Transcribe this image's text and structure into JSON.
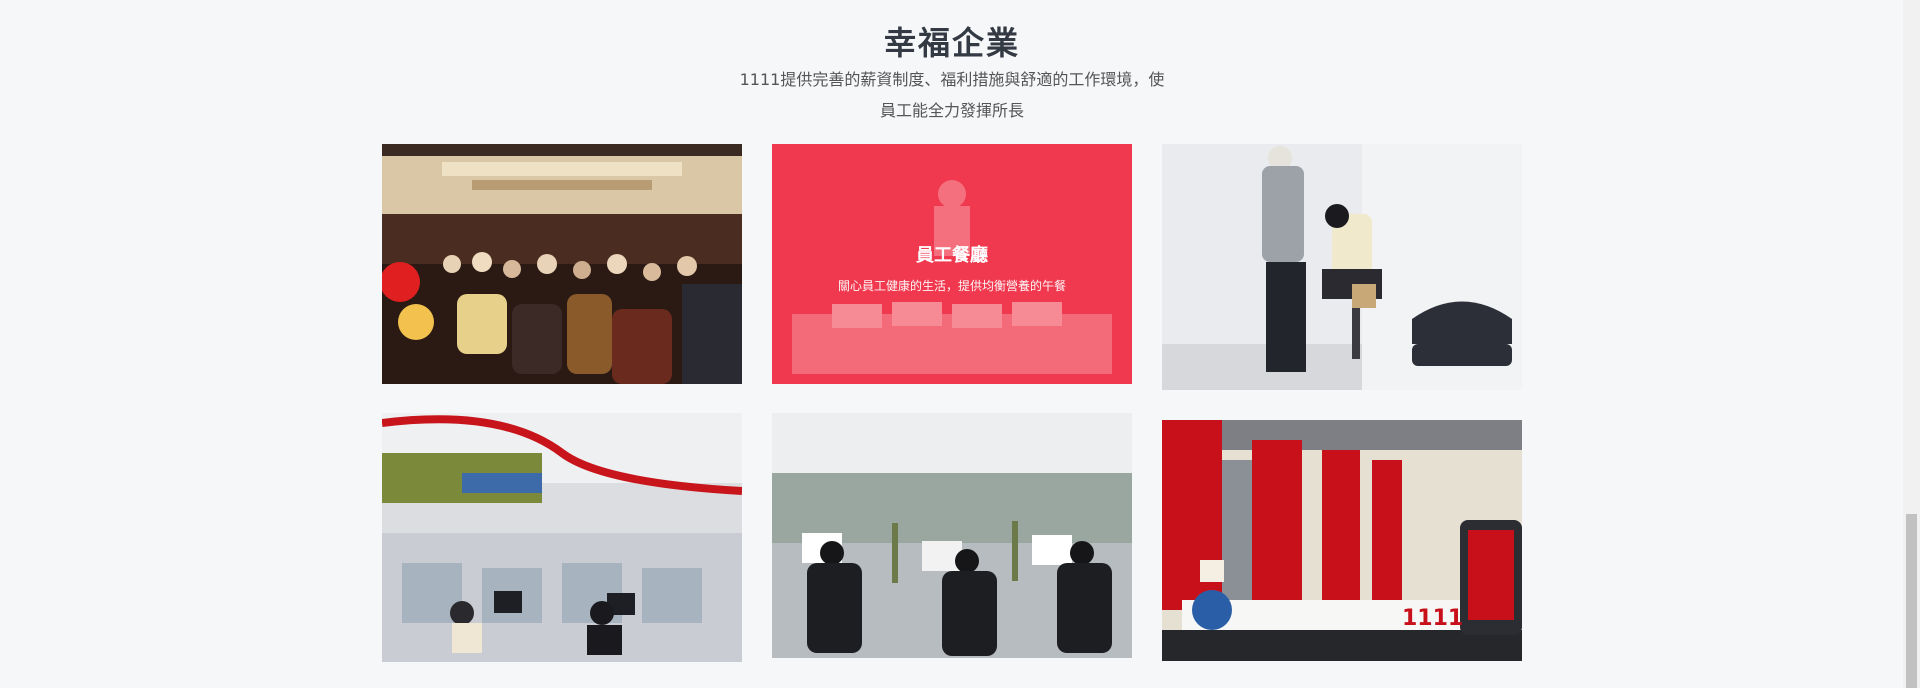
{
  "section": {
    "title": "幸福企業",
    "desc_line1": "1111提供完善的薪資制度、福利措施與舒適的工作環境，使",
    "desc_line2": "員工能全力發揮所長"
  },
  "gallery": {
    "items": [
      {
        "name": "year-end-party-photo"
      },
      {
        "name": "staff-canteen-card",
        "title": "員工餐廳",
        "subtitle": "關心員工健康的生活，提供均衡營養的午餐",
        "overlay_color": "#f0394f"
      },
      {
        "name": "massage-service-photo"
      },
      {
        "name": "office-area-photo"
      },
      {
        "name": "call-center-photo"
      },
      {
        "name": "reception-lobby-photo",
        "logo_text": "1111"
      }
    ]
  },
  "colors": {
    "accent": "#f0394f",
    "background": "#f5f7f9",
    "title": "#333a44"
  }
}
